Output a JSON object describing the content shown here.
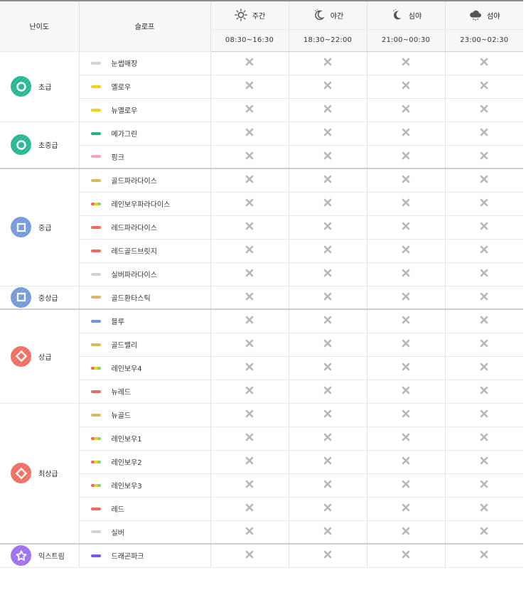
{
  "header": {
    "level_label": "난이도",
    "slope_label": "슬로프",
    "periods": [
      {
        "name": "주간",
        "time": "08:30~16:30",
        "icon": "sun-icon"
      },
      {
        "name": "야간",
        "time": "18:30~22:00",
        "icon": "moon-icon"
      },
      {
        "name": "심야",
        "time": "21:00~00:30",
        "icon": "moon-icon"
      },
      {
        "name": "섬야",
        "time": "23:00~02:30",
        "icon": "cloud-moon-icon"
      }
    ]
  },
  "status_symbol": "closed-x-icon",
  "colors": {
    "beginner": "#21b58f",
    "intermediate": "#6f97d9",
    "advanced": "#f06a5d",
    "extreme": "#9c6cf0",
    "grey_x": "#b7b7b7"
  },
  "groups": [
    {
      "level": "초급",
      "badge": "circle",
      "color": "#21b58f",
      "slopes": [
        {
          "name": "눈썹매장",
          "dash": [
            "#cfd3d8"
          ]
        },
        {
          "name": "옐로우",
          "dash": [
            "#f2d21a"
          ]
        },
        {
          "name": "뉴옐로우",
          "dash": [
            "#f2d21a"
          ]
        }
      ]
    },
    {
      "level": "초중급",
      "badge": "circle",
      "color": "#21b58f",
      "slopes": [
        {
          "name": "메가그린",
          "dash": [
            "#23b38a"
          ]
        },
        {
          "name": "핑크",
          "dash": [
            "#f3a3c3"
          ]
        }
      ]
    },
    {
      "level": "중급",
      "badge": "square",
      "color": "#6f97d9",
      "slopes": [
        {
          "name": "골드파라다이스",
          "dash": [
            "#d9b960"
          ]
        },
        {
          "name": "레인보우파라다이스",
          "dash": [
            "#f06a5d",
            "#f2d21a",
            "#7fd36b"
          ]
        },
        {
          "name": "레드파라다이스",
          "dash": [
            "#f06a5d"
          ]
        },
        {
          "name": "레드골드브릿지",
          "dash": [
            "#f06a5d"
          ]
        },
        {
          "name": "실버파라다이스",
          "dash": [
            "#cfd3d8"
          ]
        }
      ]
    },
    {
      "level": "중상급",
      "badge": "square",
      "color": "#6f97d9",
      "slopes": [
        {
          "name": "골드환타스틱",
          "dash": [
            "#d9b960"
          ]
        }
      ]
    },
    {
      "level": "상급",
      "badge": "diamond",
      "color": "#f06a5d",
      "slopes": [
        {
          "name": "블루",
          "dash": [
            "#6f97d9"
          ]
        },
        {
          "name": "골드밸리",
          "dash": [
            "#d9b960"
          ]
        },
        {
          "name": "레인보우4",
          "dash": [
            "#f06a5d",
            "#f2d21a",
            "#7fd36b"
          ]
        },
        {
          "name": "뉴레드",
          "dash": [
            "#f06a5d"
          ]
        }
      ]
    },
    {
      "level": "최상급",
      "badge": "diamond",
      "color": "#f06a5d",
      "slopes": [
        {
          "name": "뉴골드",
          "dash": [
            "#d9b960"
          ]
        },
        {
          "name": "레인보우1",
          "dash": [
            "#f06a5d",
            "#f2d21a",
            "#7fd36b"
          ]
        },
        {
          "name": "레인보우2",
          "dash": [
            "#f06a5d",
            "#f2d21a",
            "#7fd36b"
          ]
        },
        {
          "name": "레인보우3",
          "dash": [
            "#f06a5d",
            "#f2d21a",
            "#7fd36b"
          ]
        },
        {
          "name": "레드",
          "dash": [
            "#f06a5d"
          ]
        },
        {
          "name": "실버",
          "dash": [
            "#cfd3d8"
          ]
        }
      ]
    },
    {
      "level": "익스트림",
      "badge": "star",
      "color": "#9c6cf0",
      "slopes": [
        {
          "name": "드래곤파크",
          "dash": [
            "#7b55f0"
          ]
        }
      ]
    }
  ]
}
